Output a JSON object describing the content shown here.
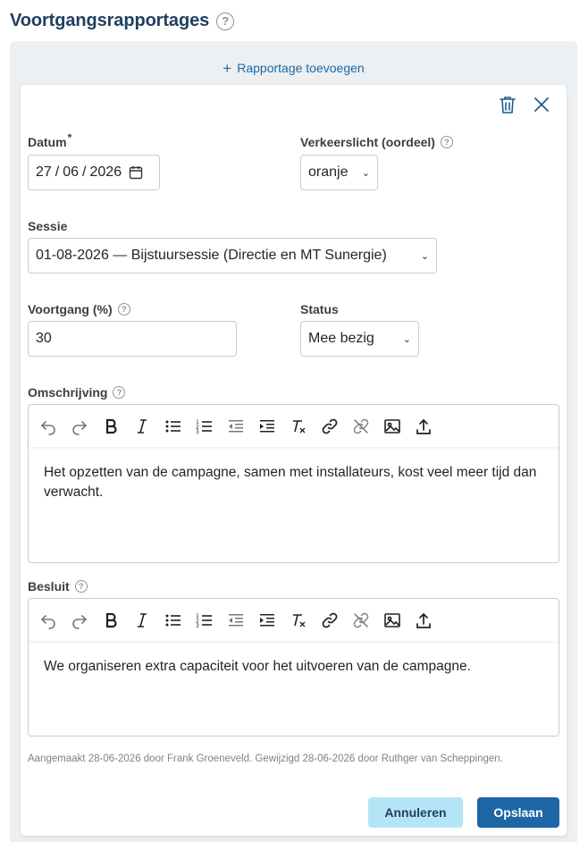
{
  "header": {
    "title": "Voortgangsrapportages"
  },
  "panel": {
    "add_label": "Rapportage toevoegen"
  },
  "form": {
    "datum": {
      "label": "Datum",
      "required_mark": "*",
      "day": "27",
      "month": "06",
      "year": "2026"
    },
    "verkeerslicht": {
      "label": "Verkeerslicht (oordeel)",
      "value": "oranje"
    },
    "sessie": {
      "label": "Sessie",
      "value": "01-08-2026 — Bijstuursessie (Directie en MT Sunergie)"
    },
    "voortgang": {
      "label": "Voortgang (%)",
      "value": "30"
    },
    "status": {
      "label": "Status",
      "value": "Mee bezig"
    },
    "omschrijving": {
      "label": "Omschrijving",
      "text": "Het opzetten van de campagne, samen met installateurs, kost veel meer tijd dan verwacht."
    },
    "besluit": {
      "label": "Besluit",
      "text": "We organiseren extra capaciteit voor het uitvoeren van de campagne."
    }
  },
  "meta": {
    "text": "Aangemaakt 28-06-2026 door Frank Groeneveld. Gewijzigd 28-06-2026 door Ruthger van Scheppingen."
  },
  "actions": {
    "cancel": "Annuleren",
    "save": "Opslaan"
  },
  "colors": {
    "title": "#1f3f5e",
    "link": "#1b6aa5",
    "save": "#1e67a6",
    "cancel": "#b3e5f6",
    "panel": "#edf0f2"
  }
}
